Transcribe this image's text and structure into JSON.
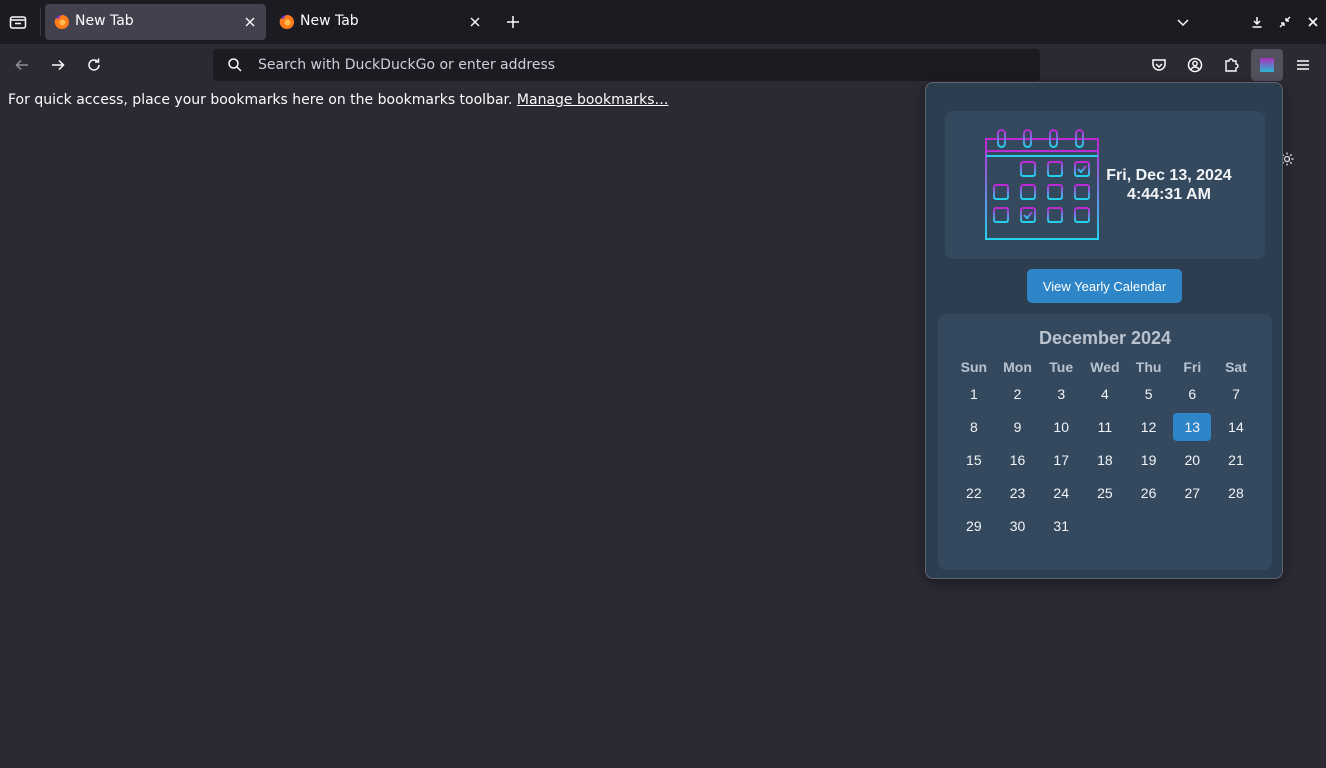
{
  "tabs": [
    {
      "title": "New Tab",
      "active": true
    },
    {
      "title": "New Tab",
      "active": false
    }
  ],
  "urlbar": {
    "placeholder": "Search with DuckDuckGo or enter address"
  },
  "bookmarks_bar": {
    "message": "For quick access, place your bookmarks here on the bookmarks toolbar. ",
    "link": "Manage bookmarks…"
  },
  "popup": {
    "date": "Fri, Dec 13, 2024",
    "time": "4:44:31 AM",
    "yearly_button": "View Yearly Calendar",
    "month_title": "December 2024",
    "weekdays": [
      "Sun",
      "Mon",
      "Tue",
      "Wed",
      "Thu",
      "Fri",
      "Sat"
    ],
    "days": [
      "1",
      "2",
      "3",
      "4",
      "5",
      "6",
      "7",
      "8",
      "9",
      "10",
      "11",
      "12",
      "13",
      "14",
      "15",
      "16",
      "17",
      "18",
      "19",
      "20",
      "21",
      "22",
      "23",
      "24",
      "25",
      "26",
      "27",
      "28",
      "29",
      "30",
      "31"
    ],
    "today": "13"
  },
  "colors": {
    "popup_bg": "#2c3e50",
    "panel_bg": "#34495e",
    "accent": "#2e86c8",
    "calendar_gradient": [
      "#c026d3",
      "#22d3ee"
    ]
  }
}
